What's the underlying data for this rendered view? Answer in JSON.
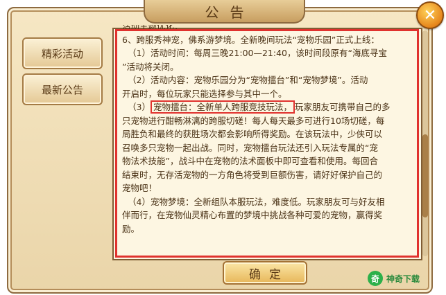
{
  "dialog": {
    "title": "公告",
    "close_symbol": "✕"
  },
  "sidebar": {
    "items": [
      {
        "label": "精彩活动"
      },
      {
        "label": "最新公告"
      }
    ]
  },
  "notice": {
    "line_partial": "活动主题优化：",
    "line_6": "6、跨服秀神宠，佛系游梦境。全新晚间玩法“宠物乐园”正式上线：",
    "p1_a": "（1）活动时间：每周三晚21:00—21:40，该时间段原有“海底寻宝",
    "p1_b": "”活动将关闭。",
    "p2_a": "（2）活动内容：宠物乐园分为“宠物擂台”和“宠物梦境”。活动",
    "p2_b": "开启时，每位玩家只能选择参与其中一个。",
    "p3_prefix": "（3）",
    "p3_boxed": "宠物擂台：全新单人跨服竞技玩法，",
    "p3_suffix": "玩家朋友可携带自己的多",
    "p3_l2": "只宠物进行酣畅淋漓的跨服切磋！每人每天最多可进行10场切磋，每",
    "p3_l3": "局胜负和最终的获胜场次都会影响所得奖励。在该玩法中，少侠可以",
    "p3_l4": "召唤多只宠物一起出战。同时，宠物擂台玩法还引入玩法专属的“宠",
    "p3_l5": "物法术技能”，战斗中在宠物的法术面板中即可查看和使用。每回合",
    "p3_l6": "结束时，无存活宠物的一方角色将受到巨额伤害，请好好保护自己的",
    "p3_l7": "宠物吧！",
    "p4_a": "（4）宠物梦境：全新组队本服玩法，难度低。玩家朋友可与好友相",
    "p4_b": "伴而行，在宠物仙灵精心布置的梦境中挑战各种可爱的宠物，赢得奖",
    "p4_c": "励。"
  },
  "footer": {
    "ok_label": "确定"
  },
  "watermark": {
    "logo_glyph": "奇",
    "text": "神奇下载"
  },
  "colors": {
    "highlight": "#e0322e",
    "panel_bg": "#f6e7c4",
    "text": "#4a3216"
  }
}
